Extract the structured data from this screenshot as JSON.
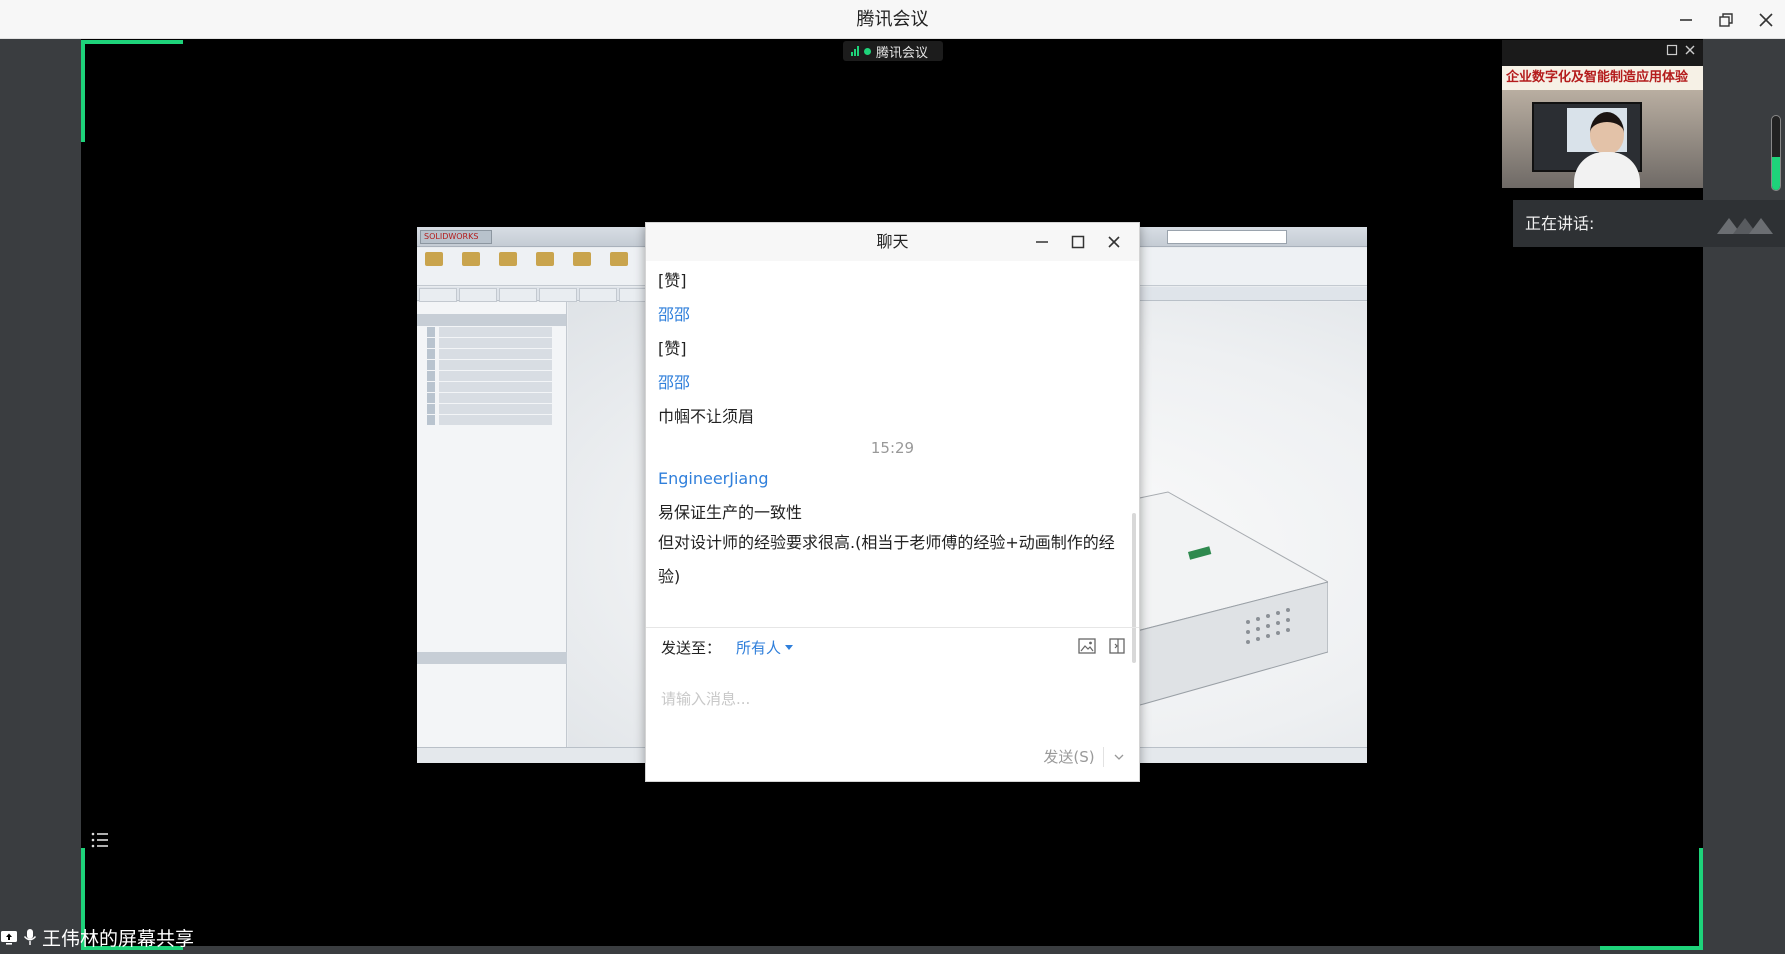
{
  "window": {
    "title": "腾讯会议"
  },
  "meeting_tag": {
    "label": "腾讯会议"
  },
  "chat": {
    "title": "聊天",
    "messages": [
      {
        "kind": "text",
        "text": "[赞]"
      },
      {
        "kind": "sender",
        "text": "邵邵"
      },
      {
        "kind": "text",
        "text": "[赞]"
      },
      {
        "kind": "sender",
        "text": "邵邵"
      },
      {
        "kind": "text",
        "text": "巾帼不让须眉"
      },
      {
        "kind": "time",
        "text": "15:29"
      },
      {
        "kind": "sender",
        "text": "EngineerJiang"
      },
      {
        "kind": "text",
        "text": "易保证生产的一致性"
      },
      {
        "kind": "text",
        "text": "但对设计师的经验要求很高.(相当于老师傅的经验+动画制作的经验)"
      }
    ],
    "send_to_label": "发送至：",
    "send_to_target": "所有人",
    "input_placeholder": "请输入消息...",
    "send_button": "发送(S)"
  },
  "speaker": {
    "video_banner": "企业数字化及智能制造应用体验",
    "speaking_label": "正在讲话:",
    "volume_level": 0.45
  },
  "screen_share": {
    "app_logo": "SOLIDWORKS",
    "label": "王伟林的屏幕共享"
  },
  "colors": {
    "accent_green": "#1ed37a",
    "link_blue": "#2f7fdb",
    "side_grey": "#3a3d40"
  },
  "icons": [
    "minimize-icon",
    "restore-icon",
    "close-icon",
    "maximize-icon",
    "image-icon",
    "screenshot-icon",
    "chevron-down-icon",
    "list-icon",
    "screen-share-icon",
    "mic-icon",
    "signal-icon"
  ]
}
